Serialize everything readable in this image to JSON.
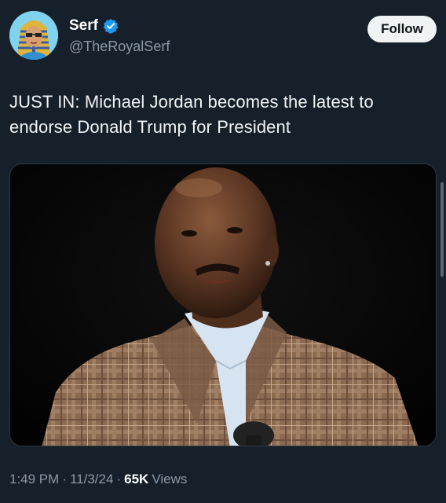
{
  "author": {
    "display_name": "Serf",
    "handle": "@TheRoyalSerf",
    "verified": true,
    "avatar_icon": "pharaoh-avatar"
  },
  "follow_label": "Follow",
  "tweet": {
    "text_line1": "JUST IN: Michael Jordan becomes the latest to",
    "text_line2": "endorse Donald Trump for President"
  },
  "media": {
    "kind": "photo"
  },
  "meta": {
    "time": "1:49 PM",
    "separator": "·",
    "date": "11/3/24",
    "views_count": "65K",
    "views_label": "Views"
  },
  "colors": {
    "background": "#15202b",
    "verified_blue": "#1d9bf0",
    "secondary_text": "#8b98a5",
    "follow_bg": "#eff3f4"
  }
}
